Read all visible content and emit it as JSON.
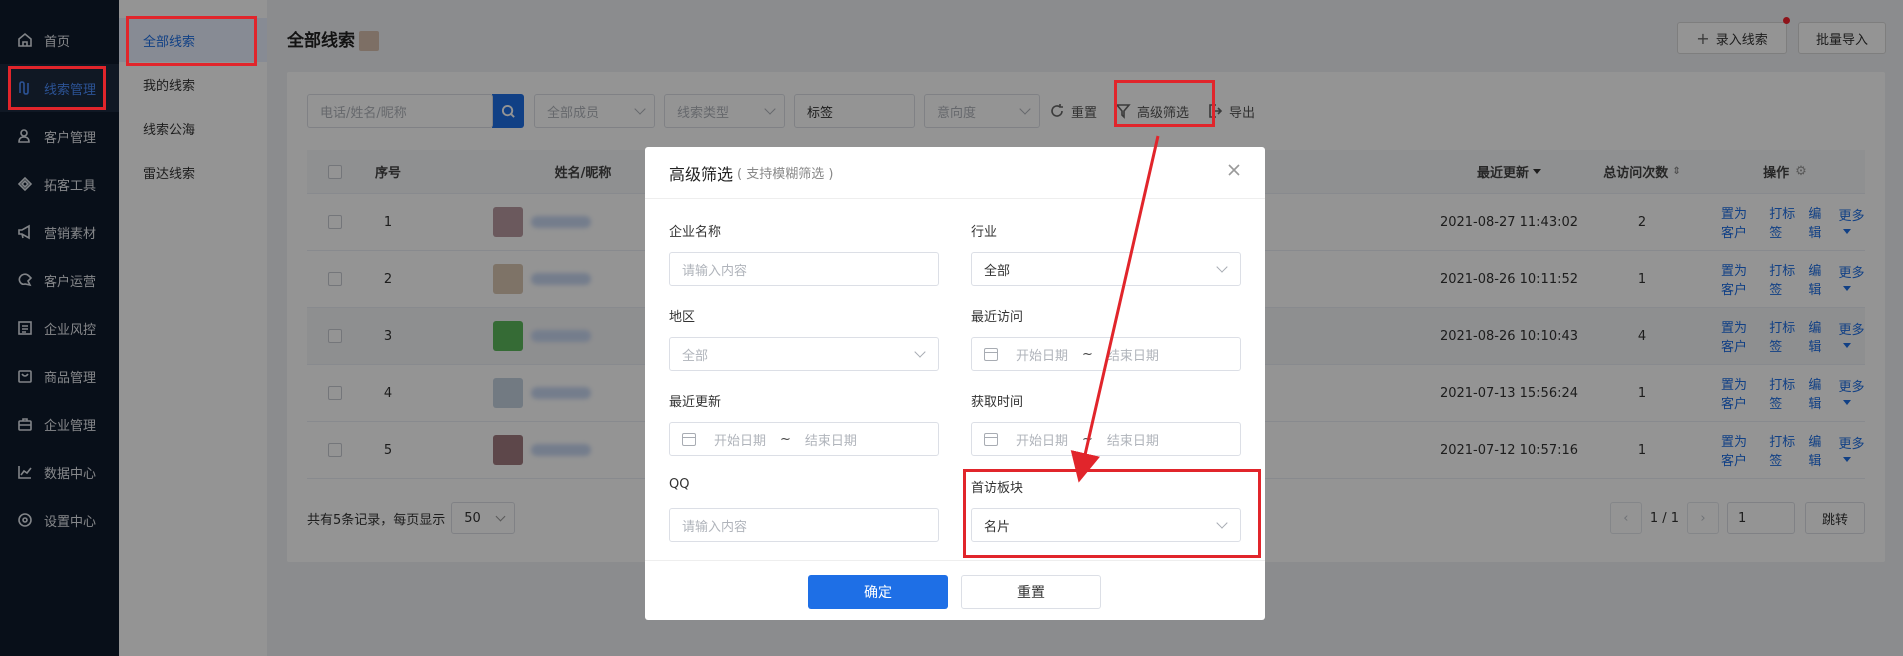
{
  "nav": {
    "items": [
      {
        "label": "首页",
        "icon": "home-icon"
      },
      {
        "label": "线索管理",
        "icon": "leads-icon",
        "active": true
      },
      {
        "label": "客户管理",
        "icon": "customers-icon"
      },
      {
        "label": "拓客工具",
        "icon": "tools-icon"
      },
      {
        "label": "营销素材",
        "icon": "megaphone-icon"
      },
      {
        "label": "客户运营",
        "icon": "operations-icon"
      },
      {
        "label": "企业风控",
        "icon": "risk-icon"
      },
      {
        "label": "商品管理",
        "icon": "bag-icon"
      },
      {
        "label": "企业管理",
        "icon": "briefcase-icon"
      },
      {
        "label": "数据中心",
        "icon": "chart-icon"
      },
      {
        "label": "设置中心",
        "icon": "settings-icon"
      }
    ]
  },
  "subnav": {
    "items": [
      {
        "label": "全部线索",
        "active": true
      },
      {
        "label": "我的线索"
      },
      {
        "label": "线索公海"
      },
      {
        "label": "雷达线索"
      }
    ]
  },
  "header": {
    "title": "全部线索",
    "add_label": "录入线索",
    "bulk_label": "批量导入"
  },
  "filters": {
    "search_placeholder": "电话/姓名/昵称",
    "member": "全部成员",
    "type": "线索类型",
    "tag": "标签",
    "intent": "意向度",
    "reset": "重置",
    "advanced": "高级筛选",
    "export": "导出"
  },
  "table": {
    "headers": {
      "index": "序号",
      "name": "姓名/昵称",
      "updated": "最近更新",
      "visits": "总访问次数",
      "actions": "操作"
    },
    "rows": [
      {
        "idx": "1",
        "updated": "2021-08-27 11:43:02",
        "visits": "2",
        "avatar": "#b89aa0"
      },
      {
        "idx": "2",
        "updated": "2021-08-26 10:11:52",
        "visits": "1",
        "avatar": "#d9c7b2"
      },
      {
        "idx": "3",
        "updated": "2021-08-26 10:10:43",
        "visits": "4",
        "avatar": "#5cb85c"
      },
      {
        "idx": "4",
        "updated": "2021-07-13 15:56:24",
        "visits": "1",
        "avatar": "#c5d3e0"
      },
      {
        "idx": "5",
        "updated": "2021-07-12 10:57:16",
        "visits": "1",
        "avatar": "#a07a80"
      }
    ],
    "action_labels": {
      "set_customer": "置为客户",
      "tag": "打标签",
      "edit": "编辑",
      "more": "更多"
    }
  },
  "pager": {
    "summary": "共有5条记录，每页显示",
    "size": "50",
    "page": "1 / 1",
    "input": "1",
    "jump": "跳转"
  },
  "modal": {
    "title": "高级筛选",
    "subtitle": "( 支持模糊筛选 )",
    "company_label": "企业名称",
    "company_placeholder": "请输入内容",
    "industry_label": "行业",
    "industry_value": "全部",
    "region_label": "地区",
    "region_value": "全部",
    "recent_visit_label": "最近访问",
    "recent_update_label": "最近更新",
    "acquire_label": "获取时间",
    "start_date": "开始日期",
    "end_date": "结束日期",
    "tilde": "~",
    "qq_label": "QQ",
    "qq_placeholder": "请输入内容",
    "first_visit_label": "首访板块",
    "first_visit_value": "名片",
    "confirm": "确定",
    "reset": "重置"
  },
  "colors": {
    "primary": "#1e6fe6",
    "nav_bg": "#0f1a2b",
    "annotation": "#e1252b"
  }
}
